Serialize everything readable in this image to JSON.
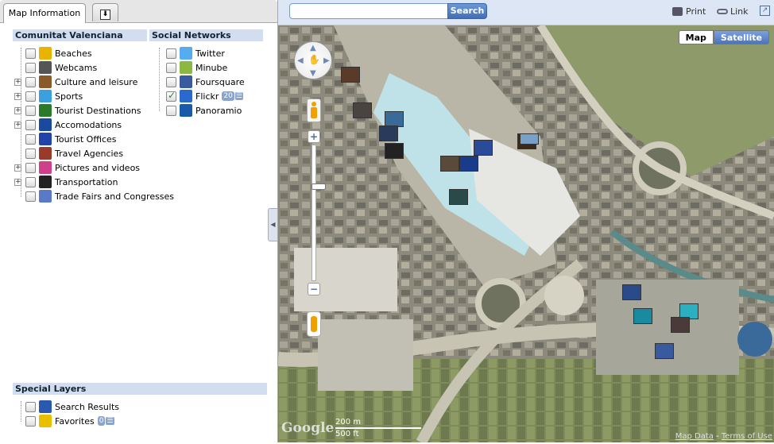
{
  "tabs": {
    "info_label": "Map Information",
    "download_icon": "download-icon"
  },
  "sections": {
    "cv": "Comunitat Valenciana",
    "social": "Social Networks",
    "special": "Special Layers"
  },
  "cv_items": [
    {
      "label": "Beaches",
      "icon": "beach-icon",
      "expandable": false,
      "checked": false,
      "color": "#e8b400"
    },
    {
      "label": "Webcams",
      "icon": "webcam-icon",
      "expandable": false,
      "checked": false,
      "color": "#555555"
    },
    {
      "label": "Culture and leisure",
      "icon": "culture-icon",
      "expandable": true,
      "checked": false,
      "color": "#8a5a2a"
    },
    {
      "label": "Sports",
      "icon": "sports-icon",
      "expandable": true,
      "checked": false,
      "color": "#3aa0e0"
    },
    {
      "label": "Tourist Destinations",
      "icon": "destination-icon",
      "expandable": true,
      "checked": false,
      "color": "#2a7a2a"
    },
    {
      "label": "Accomodations",
      "icon": "hotel-icon",
      "expandable": true,
      "checked": false,
      "color": "#1a4aa0"
    },
    {
      "label": "Tourist Offices",
      "icon": "office-icon",
      "expandable": false,
      "checked": false,
      "color": "#2244aa"
    },
    {
      "label": "Travel Agencies",
      "icon": "agency-icon",
      "expandable": false,
      "checked": false,
      "color": "#9a3a2a"
    },
    {
      "label": "Pictures and videos",
      "icon": "camera-icon",
      "expandable": true,
      "checked": false,
      "color": "#d0408a"
    },
    {
      "label": "Transportation",
      "icon": "train-icon",
      "expandable": true,
      "checked": false,
      "color": "#222222"
    },
    {
      "label": "Trade Fairs and Congresses",
      "icon": "fair-icon",
      "expandable": false,
      "checked": false,
      "color": "#5a7ac8"
    }
  ],
  "social_items": [
    {
      "label": "Twitter",
      "icon": "twitter-icon",
      "checked": false,
      "color": "#55acee",
      "badge": ""
    },
    {
      "label": "Minube",
      "icon": "minube-icon",
      "checked": false,
      "color": "#8ab840",
      "badge": ""
    },
    {
      "label": "Foursquare",
      "icon": "foursquare-icon",
      "checked": false,
      "color": "#3a5aa0",
      "badge": ""
    },
    {
      "label": "Flickr",
      "icon": "flickr-icon",
      "checked": true,
      "color": "#2a6ad0",
      "badge": "20"
    },
    {
      "label": "Panoramio",
      "icon": "panoramio-icon",
      "checked": false,
      "color": "#1a5aaa",
      "badge": ""
    }
  ],
  "special_items": [
    {
      "label": "Search Results",
      "icon": "search-results-icon",
      "color": "#2a5ab0",
      "badge": ""
    },
    {
      "label": "Favorites",
      "icon": "star-icon",
      "color": "#e8c000",
      "badge": "0"
    }
  ],
  "search": {
    "button": "Search",
    "value": ""
  },
  "toplinks": {
    "print": "Print",
    "link": "Link"
  },
  "map": {
    "type_map": "Map",
    "type_satellite": "Satellite",
    "selected": "Satellite",
    "scale_metric": "200 m",
    "scale_imperial": "500 ft",
    "attribution_link": "Map Data",
    "terms": "Terms of Use",
    "google": "Google"
  }
}
